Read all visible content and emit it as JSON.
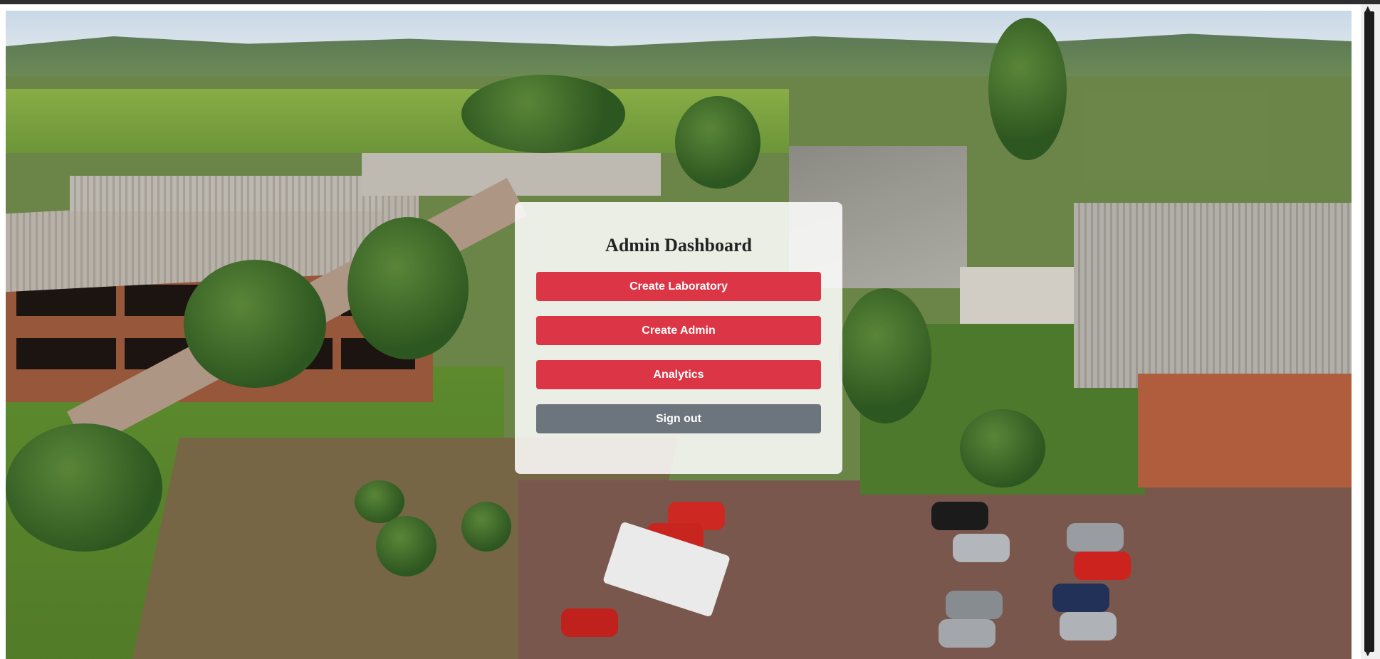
{
  "dashboard": {
    "title": "Admin Dashboard",
    "buttons": {
      "create_laboratory": "Create Laboratory",
      "create_admin": "Create Admin",
      "analytics": "Analytics",
      "sign_out": "Sign out"
    }
  },
  "colors": {
    "primary_button": "#dc3545",
    "secondary_button": "#6c757d",
    "card_background": "rgba(255,255,255,0.86)"
  },
  "background": {
    "icon": "campus-aerial-photo"
  }
}
